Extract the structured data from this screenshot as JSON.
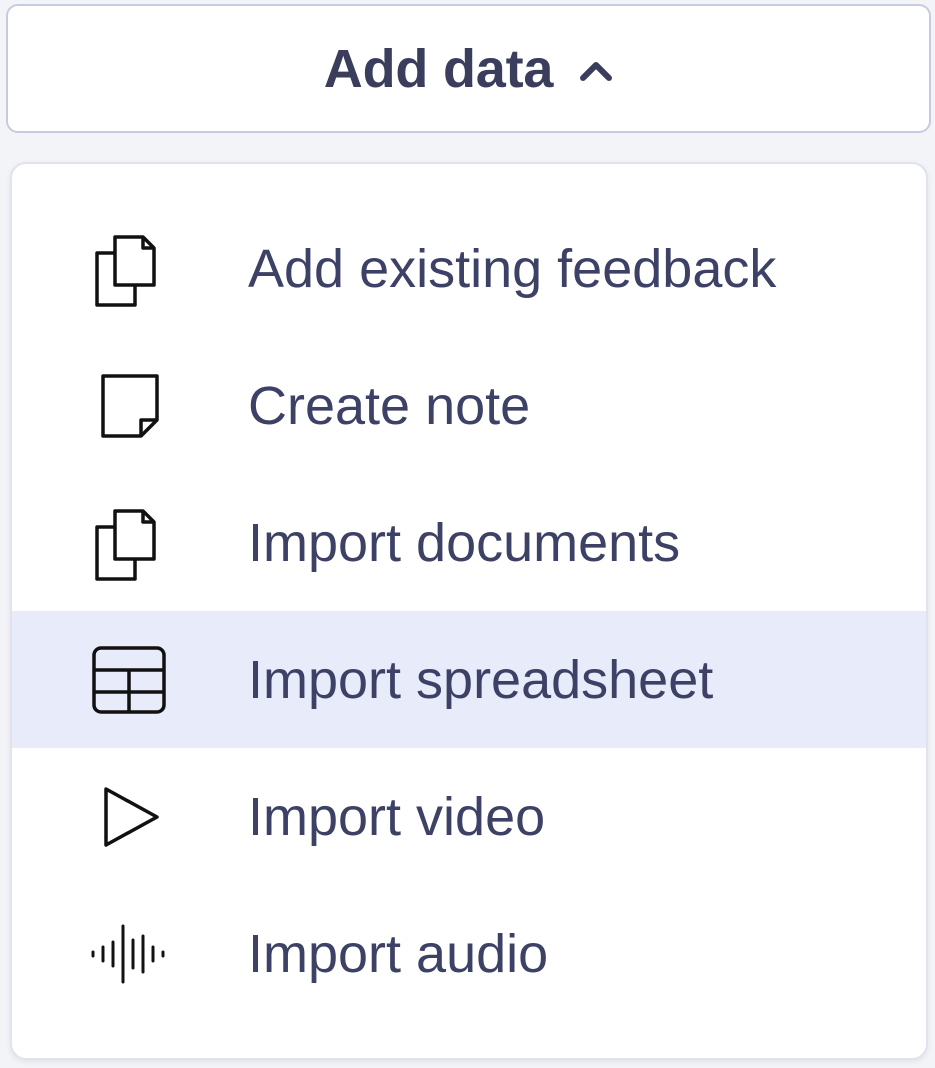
{
  "button": {
    "label": "Add data",
    "icon": "chevron-up-icon"
  },
  "menu": {
    "items": [
      {
        "label": "Add existing feedback",
        "icon": "copy-icon",
        "highlighted": false
      },
      {
        "label": "Create note",
        "icon": "note-icon",
        "highlighted": false
      },
      {
        "label": "Import documents",
        "icon": "documents-icon",
        "highlighted": false
      },
      {
        "label": "Import spreadsheet",
        "icon": "spreadsheet-icon",
        "highlighted": true
      },
      {
        "label": "Import video",
        "icon": "play-icon",
        "highlighted": false
      },
      {
        "label": "Import audio",
        "icon": "audio-waveform-icon",
        "highlighted": false
      }
    ]
  },
  "colors": {
    "text": "#3d4166",
    "highlight": "#e7ebfa",
    "border": "#c8cbe0"
  }
}
